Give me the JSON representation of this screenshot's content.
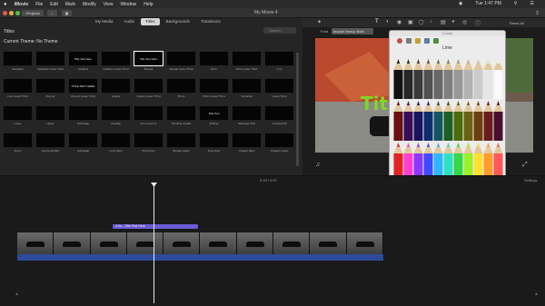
{
  "menubar": {
    "apple": "",
    "app": "iMovie",
    "items": [
      "File",
      "Edit",
      "Mark",
      "Modify",
      "View",
      "Window",
      "Help"
    ],
    "clock": "Tue 1:47 PM"
  },
  "toolbar": {
    "projects_label": "Projects",
    "doc_title": "My Movie 4"
  },
  "browser": {
    "tabs": [
      "My Media",
      "Audio",
      "Titles",
      "Backgrounds",
      "Transitions"
    ],
    "active_tab": "Titles",
    "section_title": "Titles",
    "search_placeholder": "Search",
    "theme_label": "Current Theme: No Theme",
    "titles": [
      {
        "label": "Standard",
        "preview": ""
      },
      {
        "label": "Standard Lower Third",
        "preview": ""
      },
      {
        "label": "Gradient",
        "preview": "Title Text Here"
      },
      {
        "label": "Gradient Lower Third",
        "preview": ""
      },
      {
        "label": "Reveal",
        "preview": "Title Text Here"
      },
      {
        "label": "Reveal Lower Third",
        "preview": ""
      },
      {
        "label": "Echo",
        "preview": ""
      },
      {
        "label": "Echo Lower Third",
        "preview": ""
      },
      {
        "label": "Line",
        "preview": ""
      },
      {
        "label": "Line Lower Third",
        "preview": ""
      },
      {
        "label": "Pop-up",
        "preview": ""
      },
      {
        "label": "Pop-up Lower Third",
        "preview": "TITLE TEXT HERE"
      },
      {
        "label": "Gravity",
        "preview": ""
      },
      {
        "label": "Gravity Lower Third",
        "preview": ""
      },
      {
        "label": "Prism",
        "preview": ""
      },
      {
        "label": "Prism Lower Third",
        "preview": ""
      },
      {
        "label": "Centered",
        "preview": ""
      },
      {
        "label": "Lower Third",
        "preview": ""
      },
      {
        "label": "Lower",
        "preview": ""
      },
      {
        "label": "Upper",
        "preview": ""
      },
      {
        "label": "Soft Edge",
        "preview": ""
      },
      {
        "label": "Overlap",
        "preview": ""
      },
      {
        "label": "Four Corners",
        "preview": ""
      },
      {
        "label": "Scrolling Credits",
        "preview": ""
      },
      {
        "label": "Drifting",
        "preview": "Title Text"
      },
      {
        "label": "Sideways Drift",
        "preview": ""
      },
      {
        "label": "Vertical Drift",
        "preview": ""
      },
      {
        "label": "Zoom",
        "preview": ""
      },
      {
        "label": "Horizontal Blur",
        "preview": ""
      },
      {
        "label": "Soft Edge",
        "preview": ""
      },
      {
        "label": "Lens Flare",
        "preview": ""
      },
      {
        "label": "Pull Focus",
        "preview": ""
      },
      {
        "label": "Boogie Lights",
        "preview": ""
      },
      {
        "label": "Pixie Dust",
        "preview": ""
      },
      {
        "label": "Organic Main",
        "preview": ""
      },
      {
        "label": "Organic Lower",
        "preview": ""
      }
    ]
  },
  "viewer": {
    "font_label": "Font",
    "font_value": "Impact Heavy Bold",
    "title_text": "Titl",
    "accent": "#7fd826"
  },
  "colors_panel": {
    "window_title": "Colors",
    "selected_color_name": "Lime",
    "swatch_color": "#6cd92e"
  },
  "timeline": {
    "time": "0:28 / 0:57",
    "settings_label": "Settings",
    "title_clip_label": "4.0s – Title Text Here",
    "clip_count": 10
  }
}
